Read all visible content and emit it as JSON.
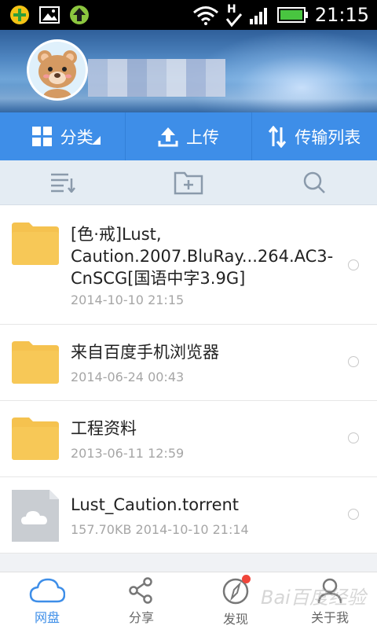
{
  "status_bar": {
    "time": "21:15",
    "icons": [
      "app-plus-icon",
      "image-icon",
      "upload-arrow-icon",
      "wifi-icon",
      "h-signal-icon",
      "cell-signal-icon",
      "battery-icon"
    ]
  },
  "header": {
    "avatar": "bear-avatar-icon",
    "username": ""
  },
  "actions": [
    {
      "label": "分类",
      "icon": "grid-icon"
    },
    {
      "label": "上传",
      "icon": "upload-icon"
    },
    {
      "label": "传输列表",
      "icon": "transfer-icon"
    }
  ],
  "toolbar": {
    "icons": [
      "sort-list-icon",
      "new-folder-icon",
      "search-icon"
    ]
  },
  "files": [
    {
      "name": "[色·戒]Lust, Caution.2007.BluRay...264.AC3-CnSCG[国语中字3.9G]",
      "meta": "2014-10-10  21:15",
      "type": "folder"
    },
    {
      "name": "来自百度手机浏览器",
      "meta": "2014-06-24  00:43",
      "type": "folder"
    },
    {
      "name": "工程资料",
      "meta": "2013-06-11  12:59",
      "type": "folder"
    },
    {
      "name": "Lust_Caution.torrent",
      "meta": "157.70KB   2014-10-10  21:14",
      "type": "file"
    }
  ],
  "bottom_nav": [
    {
      "label": "网盘",
      "icon": "cloud-icon",
      "active": true
    },
    {
      "label": "分享",
      "icon": "share-icon",
      "active": false
    },
    {
      "label": "发现",
      "icon": "compass-icon",
      "active": false,
      "badge": true
    },
    {
      "label": "关于我",
      "icon": "user-icon",
      "active": false
    }
  ],
  "watermark": "Bai百度经验",
  "colors": {
    "primary": "#3e8ee8",
    "folder": "#f5c24f",
    "badge": "#f0453a",
    "toolbar_bg": "#e4ecf3"
  }
}
